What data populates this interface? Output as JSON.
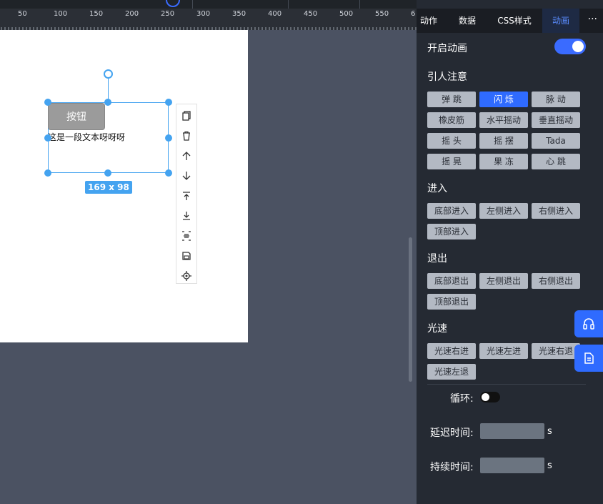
{
  "ruler": {
    "labels": [
      "50",
      "100",
      "150",
      "200",
      "250",
      "300",
      "350",
      "400",
      "450",
      "500",
      "550",
      "6"
    ]
  },
  "canvas": {
    "button_label": "按钮",
    "text": "这是一段文本呀呀呀",
    "size_badge": "169 x 98",
    "tools": [
      "copy-icon",
      "delete-icon",
      "arrow-up-icon",
      "arrow-down-icon",
      "move-top-icon",
      "move-bottom-icon",
      "align-center-icon",
      "save-icon",
      "target-icon"
    ]
  },
  "panel": {
    "tabs": [
      "动作",
      "数据",
      "CSS样式",
      "动画"
    ],
    "active_tab": "动画",
    "more": "···",
    "enable_label": "开启动画",
    "enable_on": true,
    "sections": {
      "attention": {
        "title": "引人注意",
        "items": [
          "弹 跳",
          "闪 烁",
          "脉 动",
          "橡皮筋",
          "水平摇动",
          "垂直摇动",
          "摇 头",
          "摇 摆",
          "Tada",
          "摇 晃",
          "果 冻",
          "心 跳"
        ],
        "active": "闪 烁"
      },
      "enter": {
        "title": "进入",
        "items": [
          "底部进入",
          "左侧进入",
          "右侧进入",
          "顶部进入"
        ]
      },
      "exit": {
        "title": "退出",
        "items": [
          "底部退出",
          "左侧退出",
          "右侧退出",
          "顶部退出"
        ]
      },
      "speed": {
        "title": "光速",
        "items": [
          "光速右进",
          "光速左进",
          "光速右退",
          "光速左退"
        ]
      }
    },
    "loop_label": "循环",
    "loop_on": false,
    "delay_label": "延迟时间",
    "delay_value": "",
    "delay_unit": "s",
    "duration_label": "持续时间",
    "duration_value": "",
    "duration_unit": "s"
  },
  "colors": {
    "accent": "#2f6bff",
    "selection": "#44a3f0",
    "panel": "#252a33",
    "workspace": "#4b5262"
  },
  "float_buttons": [
    "headphones-icon",
    "document-icon"
  ]
}
